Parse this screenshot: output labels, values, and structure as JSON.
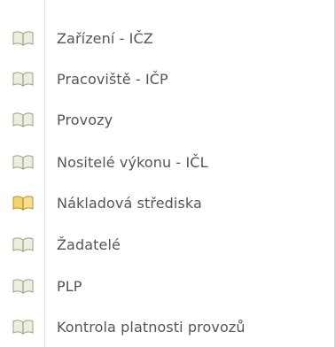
{
  "menu": {
    "items": [
      {
        "label": "Zařízení - IČZ",
        "icon": "book-icon",
        "icon_color": "#cfcfb4"
      },
      {
        "label": "Pracoviště - IČP",
        "icon": "book-icon",
        "icon_color": "#cfcfb4"
      },
      {
        "label": "Provozy",
        "icon": "book-icon",
        "icon_color": "#cfcfb4"
      },
      {
        "label": "Nositelé výkonu - IČL",
        "icon": "book-icon",
        "icon_color": "#cfcfb4"
      },
      {
        "label": "Nákladová střediska",
        "icon": "book-icon",
        "icon_color": "#e8c24a"
      },
      {
        "label": "Žadatelé",
        "icon": "book-icon",
        "icon_color": "#cfcfb4"
      },
      {
        "label": "PLP",
        "icon": "book-icon",
        "icon_color": "#cfcfb4"
      },
      {
        "label": "Kontrola platnosti provozů",
        "icon": "book-icon",
        "icon_color": "#cfcfb4"
      }
    ]
  }
}
